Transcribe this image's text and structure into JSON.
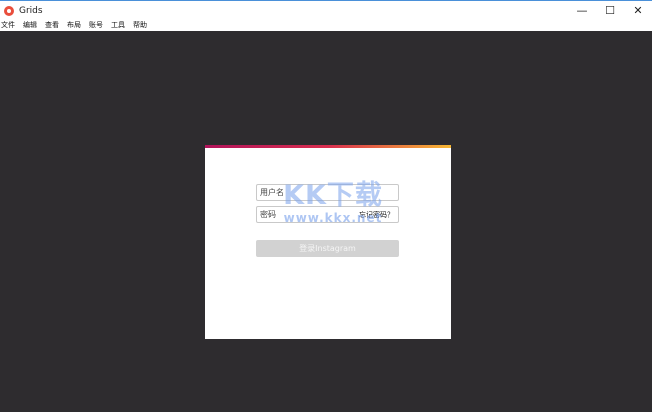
{
  "window": {
    "title": "Grids",
    "minimize_glyph": "—",
    "maximize_glyph": "☐",
    "close_glyph": "✕"
  },
  "menu": {
    "items": [
      "文件",
      "编辑",
      "查看",
      "布局",
      "账号",
      "工具",
      "帮助"
    ]
  },
  "login": {
    "username_placeholder": "用户名",
    "password_placeholder": "密码",
    "forgot_link": "忘记密码？",
    "submit_label": "登录Instagram"
  },
  "watermark": {
    "line1": "KK下载",
    "line2": "www.kkx.net"
  },
  "colors": {
    "workspace_bg": "#2e2c2f",
    "accent_start": "#b1145b",
    "accent_end": "#f7b733",
    "button_disabled": "#d2d2d2"
  },
  "icons": {
    "app": "grids-app-icon"
  }
}
